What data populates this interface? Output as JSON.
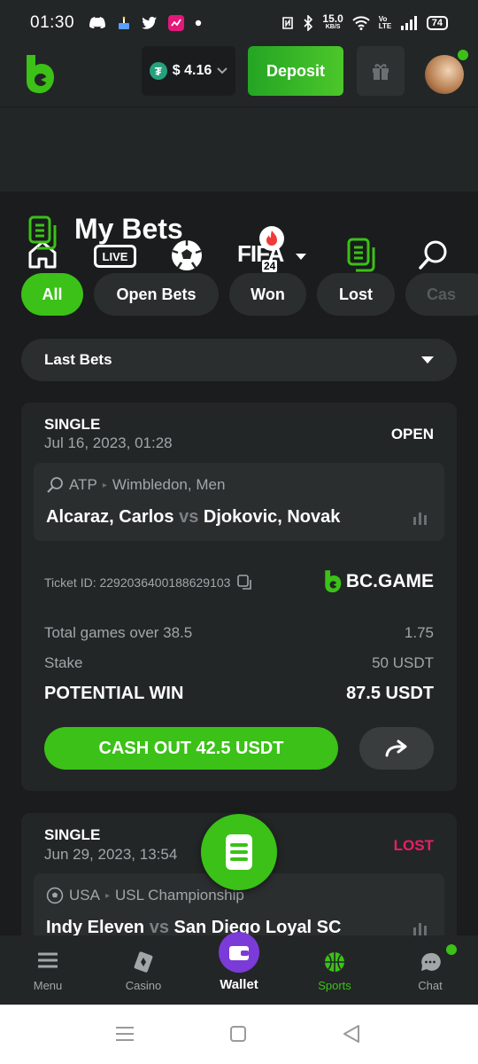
{
  "status_bar": {
    "time": "01:30",
    "net_speed": "15.0",
    "net_unit": "KB/S",
    "volte": "Vo LTE",
    "battery": "74"
  },
  "header": {
    "balance": "$ 4.16",
    "deposit_label": "Deposit"
  },
  "top_nav": {
    "live_label": "LIVE",
    "fifa_label": "FIFA",
    "fifa_year": "24"
  },
  "page": {
    "title": "My Bets"
  },
  "filters": {
    "tabs": [
      {
        "label": "All"
      },
      {
        "label": "Open Bets"
      },
      {
        "label": "Won"
      },
      {
        "label": "Lost"
      },
      {
        "label": "Cas"
      }
    ],
    "active": "All",
    "dropdown_value": "Last Bets"
  },
  "bets": [
    {
      "type": "SINGLE",
      "date": "Jul 16, 2023, 01:28",
      "status": "OPEN",
      "status_color": "#ffffff",
      "sport_icon": "tennis-icon",
      "league": "ATP",
      "league_sub": "Wimbledon, Men",
      "home": "Alcaraz, Carlos",
      "vs": "vs",
      "away": "Djokovic, Novak",
      "ticket_label": "Ticket ID: 2292036400188629103",
      "brand": "BC.GAME",
      "market": "Total games over 38.5",
      "odds": "1.75",
      "stake_label": "Stake",
      "stake": "50 USDT",
      "potential_label": "POTENTIAL WIN",
      "potential": "87.5 USDT",
      "cashout_label": "CASH OUT 42.5 USDT"
    },
    {
      "type": "SINGLE",
      "date": "Jun 29, 2023, 13:54",
      "status": "LOST",
      "status_color": "#ed1d63",
      "sport_icon": "soccer-ball-icon",
      "league": "USA",
      "league_sub": "USL Championship",
      "home": "Indy Eleven",
      "vs": "vs",
      "away": "San Diego Loyal SC"
    }
  ],
  "bottom_nav": [
    {
      "label": "Menu",
      "icon": "menu-icon"
    },
    {
      "label": "Casino",
      "icon": "casino-icon"
    },
    {
      "label": "Wallet",
      "icon": "wallet-icon"
    },
    {
      "label": "Sports",
      "icon": "basketball-icon"
    },
    {
      "label": "Chat",
      "icon": "chat-icon"
    }
  ],
  "colors": {
    "accent_green": "#3bc117",
    "lost_pink": "#ed1d63",
    "wallet_purple": "#7b3bd8",
    "background": "#1a1c1d",
    "panel": "#232626"
  }
}
